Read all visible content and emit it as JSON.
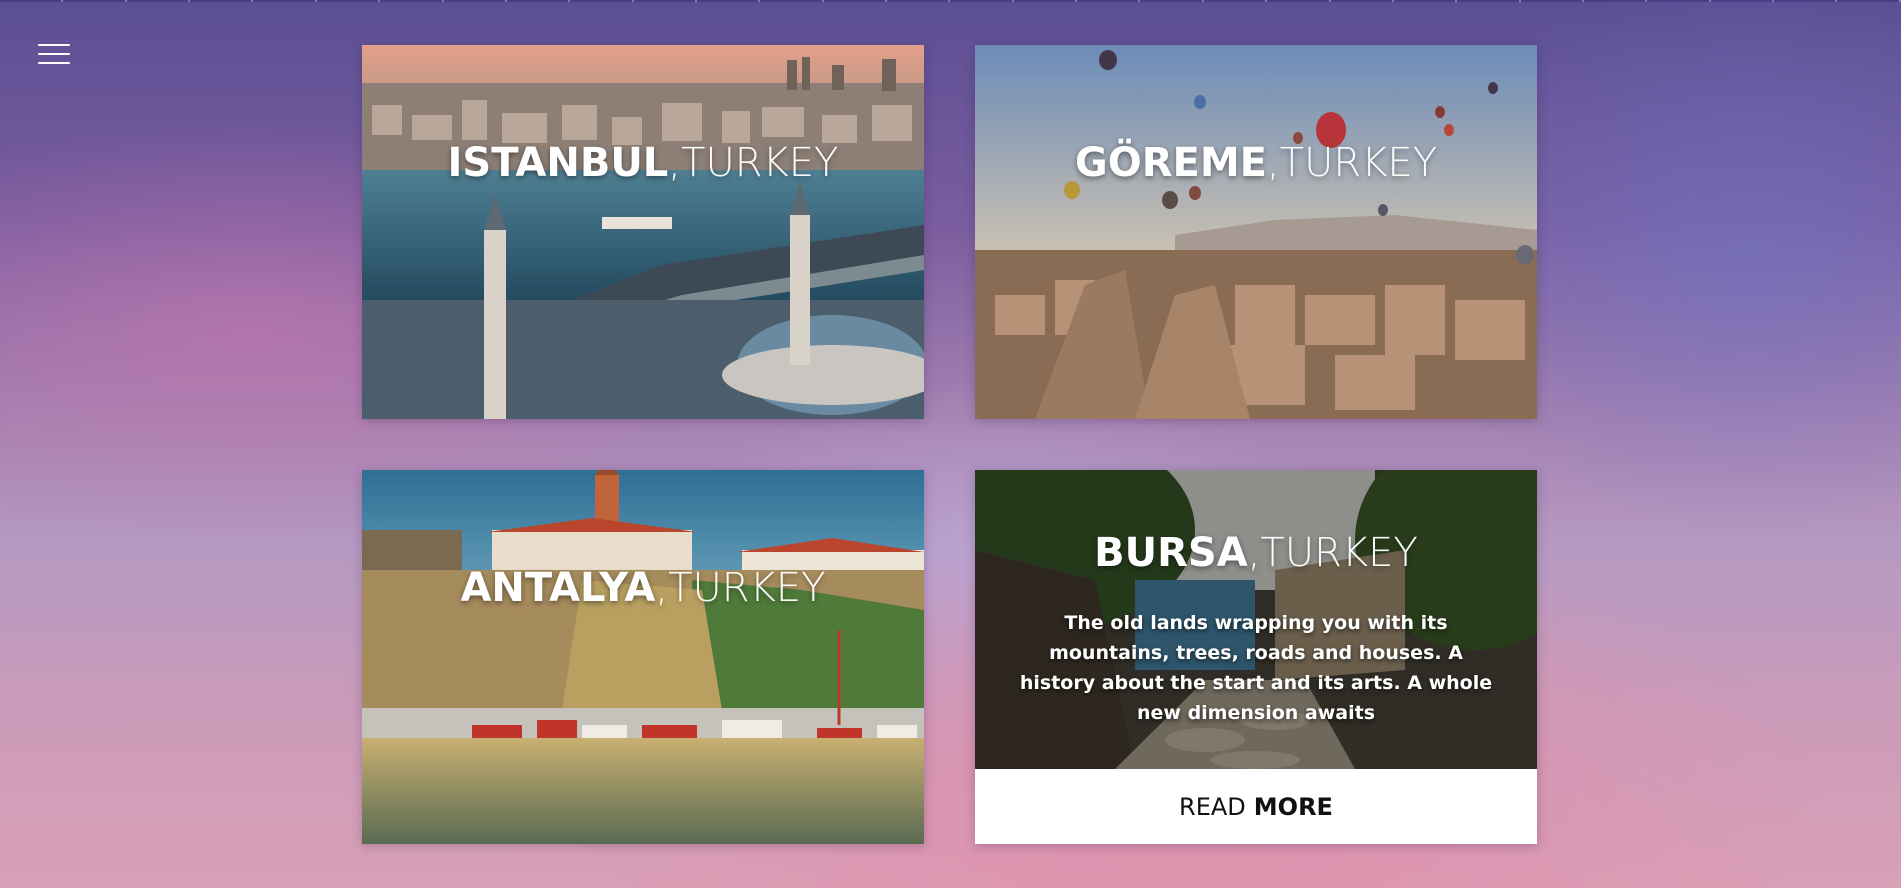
{
  "nav": {
    "menu_icon": "hamburger-menu-icon"
  },
  "cards": [
    {
      "city": "ISTANBUL",
      "country": ",TURKEY"
    },
    {
      "city": "GÖREME",
      "country": ",TURKEY"
    },
    {
      "city": "ANTALYA",
      "country": ",TURKEY"
    },
    {
      "city": "BURSA",
      "country": ",TURKEY",
      "description": "The old lands wrapping you with its mountains, trees, roads and houses. A history about the start and its arts. A whole new dimension awaits",
      "read_more_regular": "READ",
      "read_more_bold": "MORE"
    }
  ],
  "colors": {
    "background_top": "#5b4f93",
    "background_bottom": "#d9a0b6",
    "text": "#ffffff",
    "button_bg": "#ffffff",
    "button_text": "#111111"
  }
}
